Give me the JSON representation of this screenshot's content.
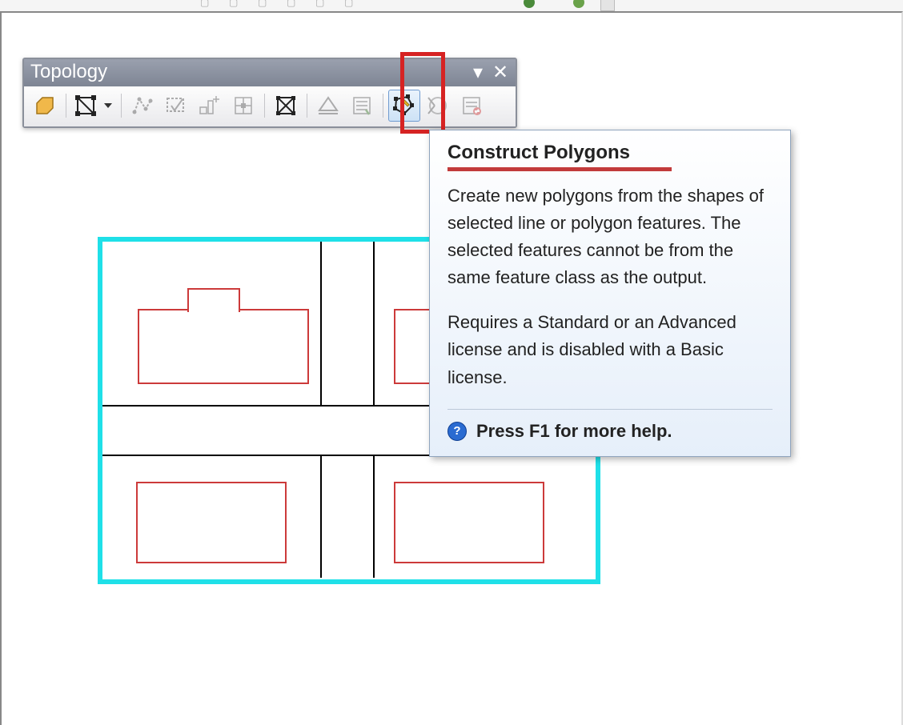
{
  "toolbar": {
    "title": "Topology",
    "buttons": {
      "select_topology": "select-topology",
      "edit_topology": "topology-edit-tool",
      "show_shared": "show-shared-features",
      "validate_extent": "validate-current-extent",
      "validate_area": "validate-topology-area",
      "fix_error": "fix-topology-error",
      "error_inspector": "error-inspector",
      "planarize": "planarize-lines",
      "construct_polygons": "construct-polygons",
      "split_polygons": "split-polygons",
      "options": "topology-options"
    }
  },
  "tooltip": {
    "title": "Construct Polygons",
    "body1": "Create new polygons from the shapes of selected line or polygon features. The selected features cannot be from the same feature class as the output.",
    "body2": "Requires a Standard or an Advanced license and is disabled with a Basic license.",
    "help": "Press F1 for more help."
  }
}
